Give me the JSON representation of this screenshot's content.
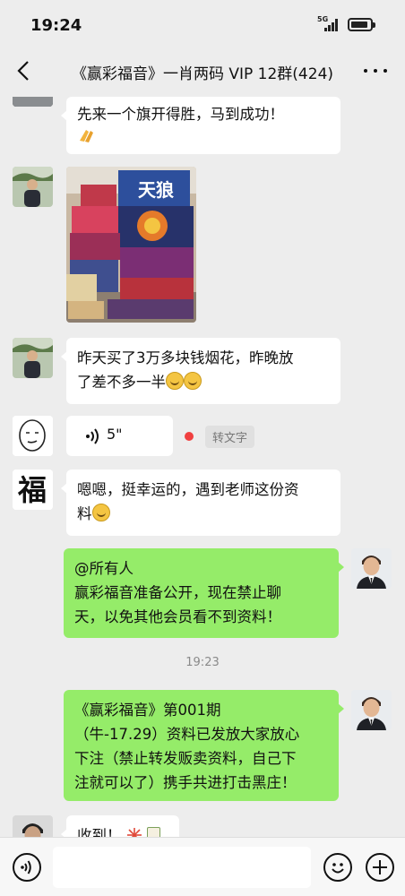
{
  "status": {
    "time": "19:24",
    "network": "5G",
    "battery_level": 0.75
  },
  "nav": {
    "title": "《赢彩福音》一肖两码 VIP 12群(424)"
  },
  "messages": {
    "m1": {
      "text": "先来一个旗开得胜，马到成功！"
    },
    "m3": {
      "line1": "昨天买了3万多块钱烟花，昨晚放",
      "line2": "了差不多一半"
    },
    "m4": {
      "duration": "5\"",
      "to_text": "转文字"
    },
    "m5": {
      "line1": "嗯嗯，挺幸运的，遇到老师这份资",
      "line2": "料"
    },
    "m6": {
      "line1": "@所有人",
      "line2": "赢彩福音准备公开，现在禁止聊",
      "line3": "天，以免其他会员看不到资料！"
    },
    "time": "19:23",
    "m7": {
      "line1": "《赢彩福音》第001期",
      "line2": "（牛-17.29）资料已发放大家放心",
      "line3": "下注（禁止转发贩卖资料，自己下",
      "line4": "注就可以了）携手共进打击黑庄！"
    },
    "m8": {
      "text": "收到！"
    }
  },
  "photo": {
    "sign_text": "天狼"
  },
  "avatars": {
    "fu_char": "福"
  }
}
